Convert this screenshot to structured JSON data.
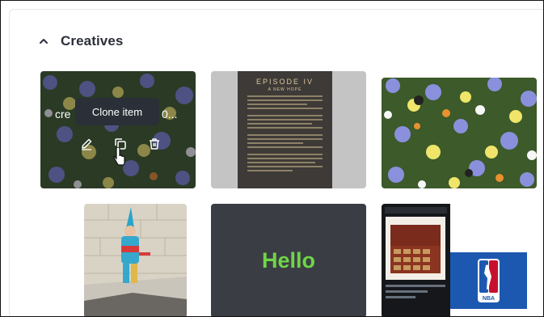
{
  "section": {
    "title": "Creatives"
  },
  "cards": [
    {
      "name_start": "cre",
      "name_end": "0..."
    },
    {
      "episode_title": "EPISODE IV",
      "episode_subtitle": "A NEW HOPE"
    },
    {},
    {},
    {
      "text": "Hello"
    },
    {
      "logo_text": "NBA"
    }
  ],
  "tooltip": "Clone item",
  "icons": {
    "edit": "pencil-icon",
    "clone": "copy-icon",
    "delete": "trash-icon",
    "collapse": "chevron-up-icon"
  },
  "colors": {
    "hello_text": "#6fd646",
    "hello_bg": "#3b3d45",
    "tooltip_bg": "#2a2f38",
    "nba_blue": "#1d58b0",
    "nba_red": "#c8102e"
  }
}
